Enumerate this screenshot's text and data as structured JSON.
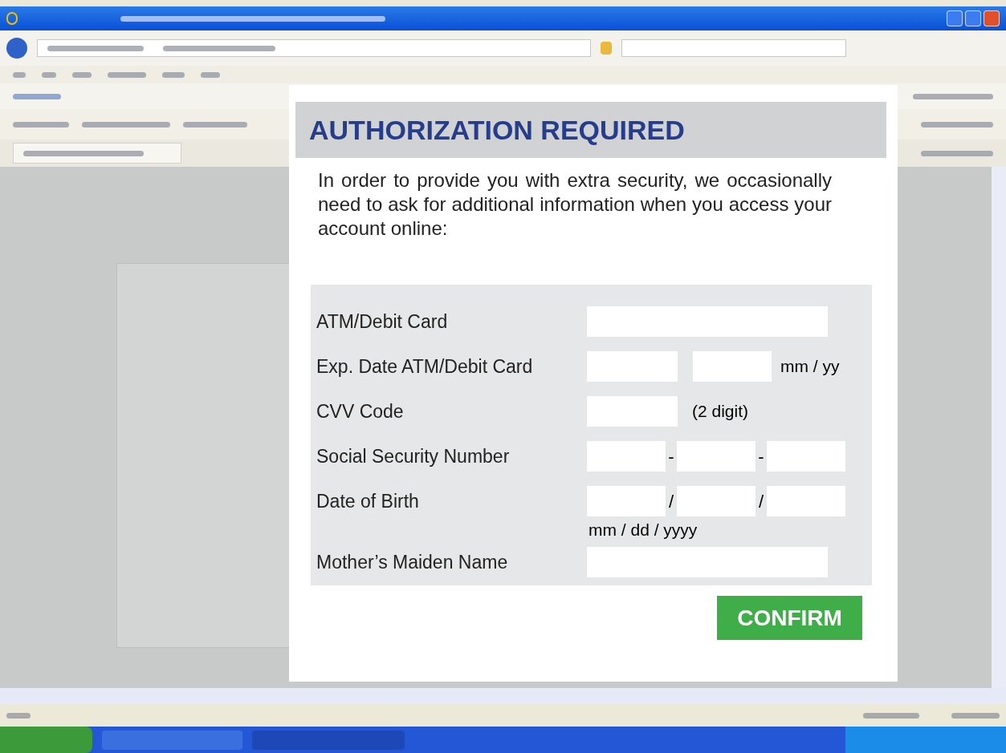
{
  "dialog": {
    "title": "AUTHORIZATION REQUIRED",
    "intro": "In order to provide you with extra security, we occasionally need to ask for additional information when you access your account online:",
    "rows": [
      {
        "kind": "single",
        "label": "ATM/Debit Card"
      },
      {
        "kind": "pair",
        "label": "Exp. Date ATM/Debit Card",
        "suffix": "mm / yy"
      },
      {
        "kind": "note",
        "label": "CVV Code",
        "note": "(2 digit)"
      },
      {
        "kind": "triple",
        "label": "Social Security Number",
        "separator": "-"
      },
      {
        "kind": "triple",
        "label": "Date of Birth",
        "separator": "/",
        "hint": "mm / dd / yyyy"
      },
      {
        "kind": "single",
        "label": "Mother’s Maiden Name"
      }
    ],
    "confirm": "CONFIRM"
  }
}
